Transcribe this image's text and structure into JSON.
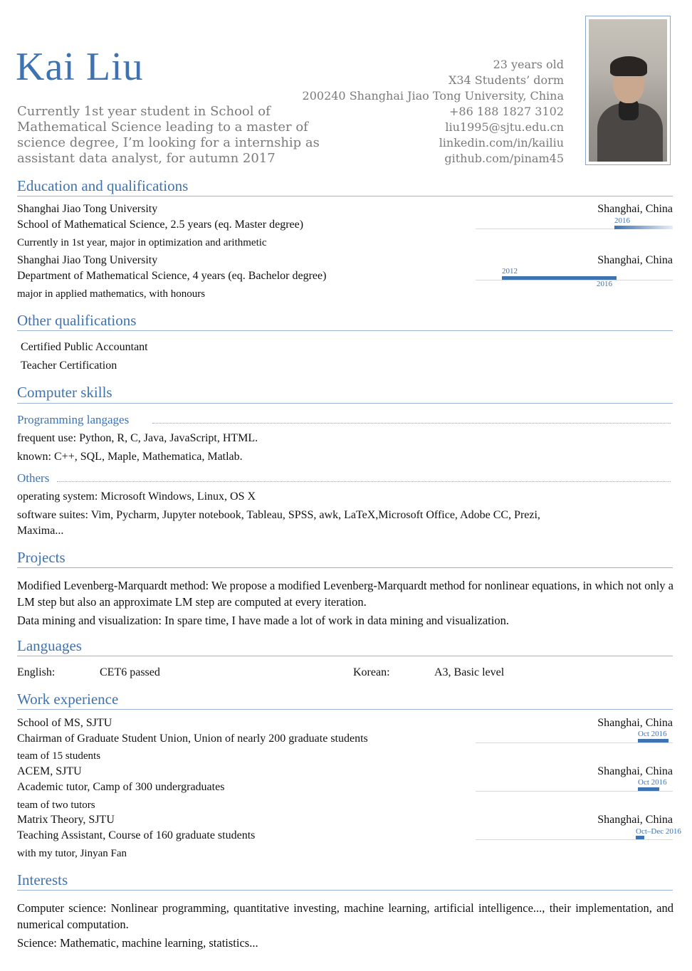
{
  "header": {
    "name": "Kai Liu",
    "summary": "Currently 1st year student in School of Mathematical Science leading to a master of science degree, I’m looking for a internship as assistant data analyst, for autumn 2017",
    "contact": [
      "23 years old",
      "X34 Students’ dorm",
      "200240 Shanghai Jiao Tong University, China",
      "+86 188 1827 3102",
      "liu1995@sjtu.edu.cn",
      "linkedin.com/in/kailiu",
      "github.com/pinam45"
    ]
  },
  "sections": {
    "education": "Education and qualifications",
    "other": "Other qualifications",
    "skills": "Computer skills",
    "projects": "Projects",
    "languages": "Languages",
    "work": "Work experience",
    "interests": "Interests"
  },
  "education": [
    {
      "school": "Shanghai Jiao Tong University",
      "location": "Shanghai, China",
      "degree": "School of Mathematical Science, 2.5 years (eq. Master degree)",
      "note": "Currently in 1st year, major in optimization and arithmetic",
      "start": "2016",
      "end": ""
    },
    {
      "school": "Shanghai Jiao Tong University",
      "location": "Shanghai, China",
      "degree": "Department of Mathematical Science, 4 years (eq. Bachelor degree)",
      "note": "major in applied mathematics, with honours",
      "start": "2012",
      "end": "2016"
    }
  ],
  "other_qualifications": [
    "Certified Public Accountant",
    "Teacher Certification"
  ],
  "skills": {
    "programming_title": "Programming langages",
    "programming": [
      "frequent use: Python, R, C, Java, JavaScript, HTML.",
      "known: C++, SQL, Maple, Mathematica, Matlab."
    ],
    "others_title": "Others",
    "os": "operating system: Microsoft Windows, Linux, OS X",
    "suites_before": "software suites: Vim, Pycharm, Jupyter notebook, Tableau, SPSS, awk,",
    "suites_latex": "LaTeX",
    "suites_after": ",Microsoft Office, Adobe CC, Prezi,",
    "suites_line2": "Maxima..."
  },
  "projects": [
    "Modified Levenberg-Marquardt method: We propose a modified Levenberg-Marquardt method for nonlinear equations, in which not only a LM step but also an approximate LM step are computed at every iteration.",
    "Data mining and visualization: In spare time, I have made a lot of work in data mining and visualization."
  ],
  "languages": [
    {
      "lang": "English:",
      "level": "CET6 passed"
    },
    {
      "lang": "Korean:",
      "level": "A3, Basic level"
    }
  ],
  "work": [
    {
      "org": "School of MS, SJTU",
      "location": "Shanghai, China",
      "role": "Chairman of Graduate Student Union, Union of nearly 200 graduate students",
      "note": "team of 15 students",
      "date": "Oct 2016"
    },
    {
      "org": "ACEM, SJTU",
      "location": "Shanghai, China",
      "role": "Academic tutor, Camp of 300 undergraduates",
      "note": "team of two tutors",
      "date": "Oct 2016"
    },
    {
      "org": "Matrix Theory, SJTU",
      "location": "Shanghai, China",
      "role": "Teaching Assistant, Course of 160 graduate students",
      "note": "with my tutor, Jinyan Fan",
      "date": "Oct–Dec 2016"
    }
  ],
  "interests": [
    "Computer science: Nonlinear programming, quantitative investing, machine learning, artificial intelligence..., their implementation, and numerical computation.",
    "Science: Mathematic, machine learning, statistics..."
  ],
  "colors": {
    "accent": "#3f72b0",
    "muted": "#7a7a7a",
    "rule": "#9bb4d4"
  }
}
